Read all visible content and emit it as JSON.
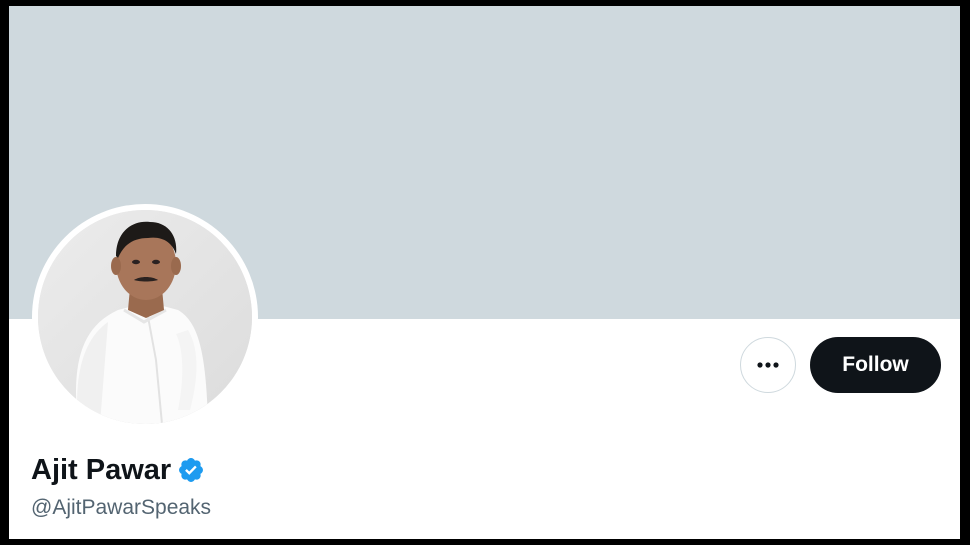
{
  "profile": {
    "display_name": "Ajit Pawar",
    "handle": "@AjitPawarSpeaks",
    "verified": true,
    "avatar_description": "profile-photo"
  },
  "actions": {
    "more_icon": "more-horizontal-icon",
    "follow_label": "Follow"
  },
  "colors": {
    "banner": "#cfd9de",
    "follow_bg": "#0f1419",
    "verified_blue": "#1d9bf0",
    "handle_text": "#536471",
    "name_text": "#0f1419"
  }
}
